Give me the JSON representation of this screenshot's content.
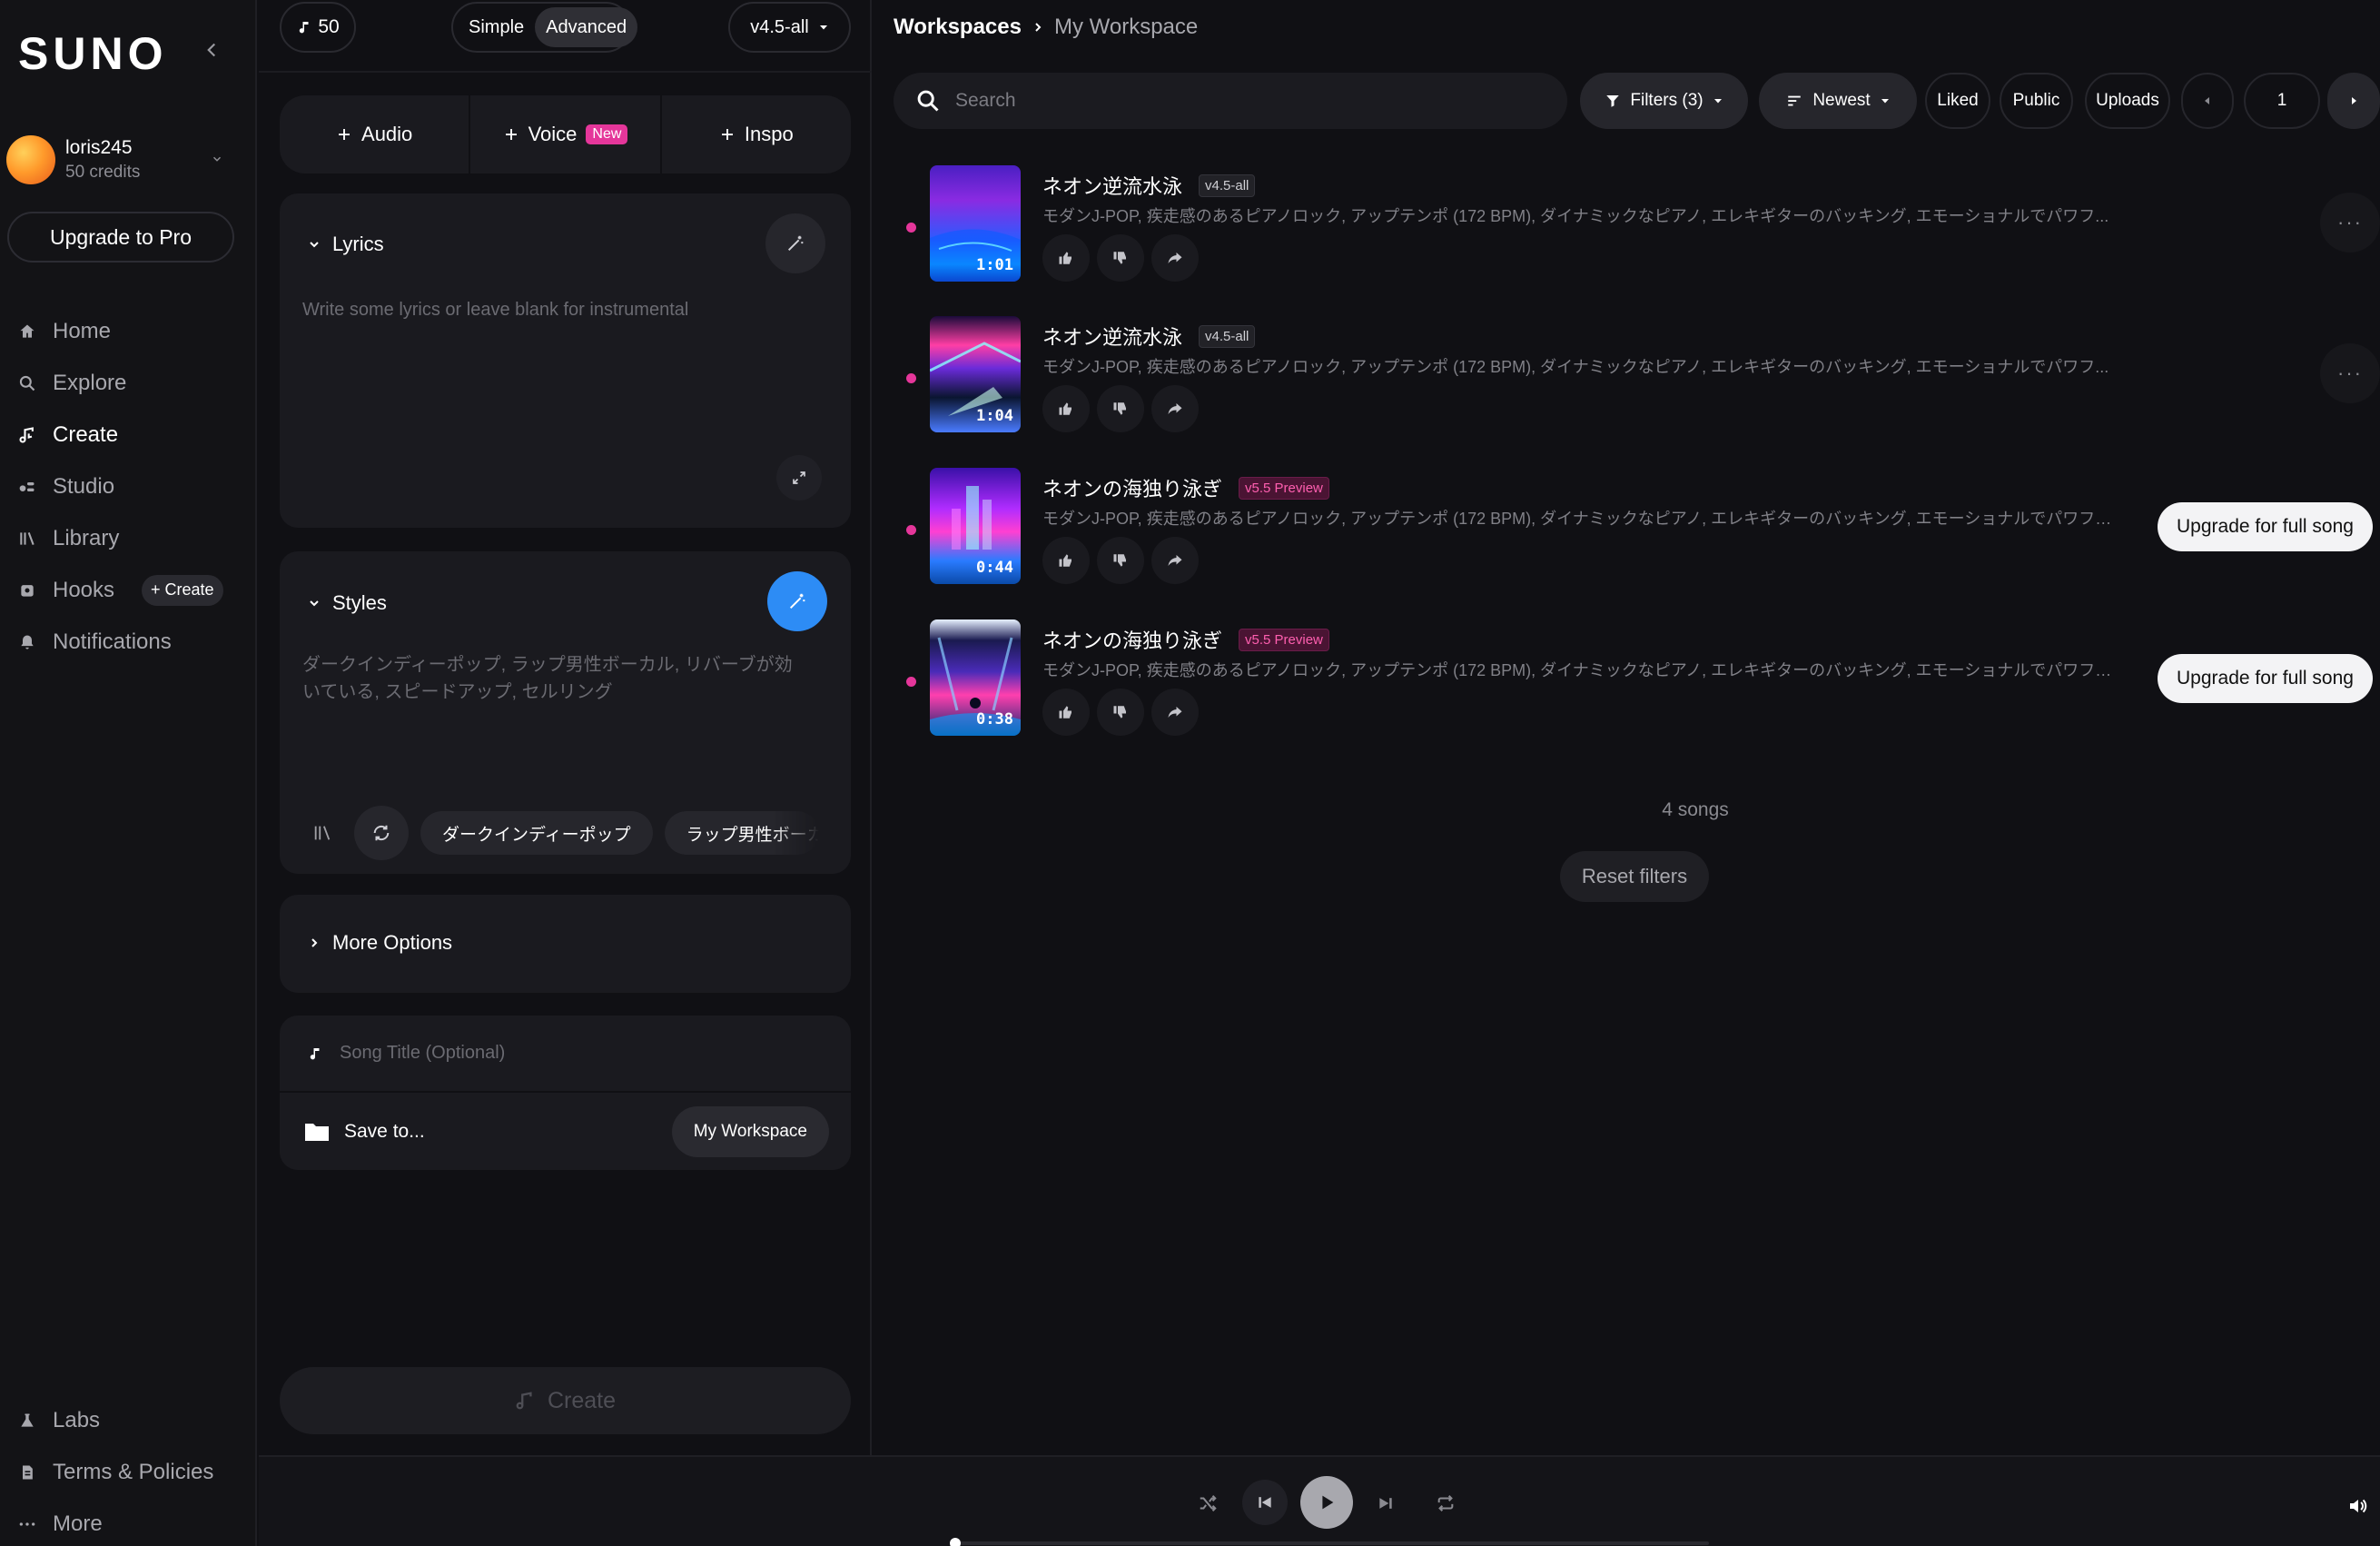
{
  "sidebar": {
    "logo": "SUNO",
    "user": {
      "name": "loris245",
      "credits": "50 credits"
    },
    "upgrade_label": "Upgrade to Pro",
    "nav": [
      {
        "label": "Home",
        "icon": "home-icon"
      },
      {
        "label": "Explore",
        "icon": "search-icon"
      },
      {
        "label": "Create",
        "icon": "music-note-icon",
        "active": true
      },
      {
        "label": "Studio",
        "icon": "studio-icon"
      },
      {
        "label": "Library",
        "icon": "library-icon"
      },
      {
        "label": "Hooks",
        "icon": "hooks-icon"
      },
      {
        "label": "Notifications",
        "icon": "bell-icon"
      }
    ],
    "hooks_create": "+ Create",
    "bottom": [
      {
        "label": "Labs",
        "icon": "flask-icon"
      },
      {
        "label": "Terms & Policies",
        "icon": "document-icon"
      },
      {
        "label": "More",
        "icon": "more-icon"
      }
    ]
  },
  "create_panel": {
    "credits_pill": "50",
    "mode": {
      "simple": "Simple",
      "advanced": "Advanced",
      "selected": "Advanced"
    },
    "version": "v4.5-all",
    "add": {
      "audio": "Audio",
      "voice": "Voice",
      "voice_badge": "New",
      "inspo": "Inspo"
    },
    "lyrics": {
      "header": "Lyrics",
      "placeholder": "Write some lyrics or leave blank for instrumental"
    },
    "styles": {
      "header": "Styles",
      "placeholder_line1": "ダークインディーポップ, ラップ男性ボーカル, リバーブが効",
      "placeholder_line2": "いている, スピードアップ, セルリング",
      "tags": [
        "ダークインディーポップ",
        "ラップ男性ボーカル"
      ]
    },
    "more_options": "More Options",
    "song_title_placeholder": "Song Title (Optional)",
    "save_to": "Save to...",
    "workspace": "My Workspace",
    "create_label": "Create"
  },
  "main": {
    "breadcrumb": {
      "root": "Workspaces",
      "current": "My Workspace"
    },
    "search_placeholder": "Search",
    "filters": "Filters (3)",
    "sort": "Newest",
    "liked": "Liked",
    "public": "Public",
    "uploads": "Uploads",
    "page": "1",
    "songs": [
      {
        "title": "ネオン逆流水泳",
        "version": "v4.5-all",
        "preview": false,
        "duration": "1:01",
        "desc": "モダンJ-POP, 疾走感のあるピアノロック, アップテンポ (172 BPM), ダイナミックなピアノ, エレキギターのバッキング, エモーショナルでパワフ...",
        "action": "more"
      },
      {
        "title": "ネオン逆流水泳",
        "version": "v4.5-all",
        "preview": false,
        "duration": "1:04",
        "desc": "モダンJ-POP, 疾走感のあるピアノロック, アップテンポ (172 BPM), ダイナミックなピアノ, エレキギターのバッキング, エモーショナルでパワフ...",
        "action": "more"
      },
      {
        "title": "ネオンの海独り泳ぎ",
        "version": "v5.5 Preview",
        "preview": true,
        "duration": "0:44",
        "desc": "モダンJ-POP, 疾走感のあるピアノロック, アップテンポ (172 BPM), ダイナミックなピアノ, エレキギターのバッキング, エモーショナルでパワフルな...",
        "action": "Upgrade for full song"
      },
      {
        "title": "ネオンの海独り泳ぎ",
        "version": "v5.5 Preview",
        "preview": true,
        "duration": "0:38",
        "desc": "モダンJ-POP, 疾走感のあるピアノロック, アップテンポ (172 BPM), ダイナミックなピアノ, エレキギターのバッキング, エモーショナルでパワフルな...",
        "action": "Upgrade for full song"
      }
    ],
    "songs_count": "4 songs",
    "reset_filters": "Reset filters"
  },
  "player": {
    "progress": 0.0
  },
  "colors": {
    "accent_pink": "#e5369a",
    "accent_blue": "#2d8cf5",
    "bg": "#101014"
  }
}
